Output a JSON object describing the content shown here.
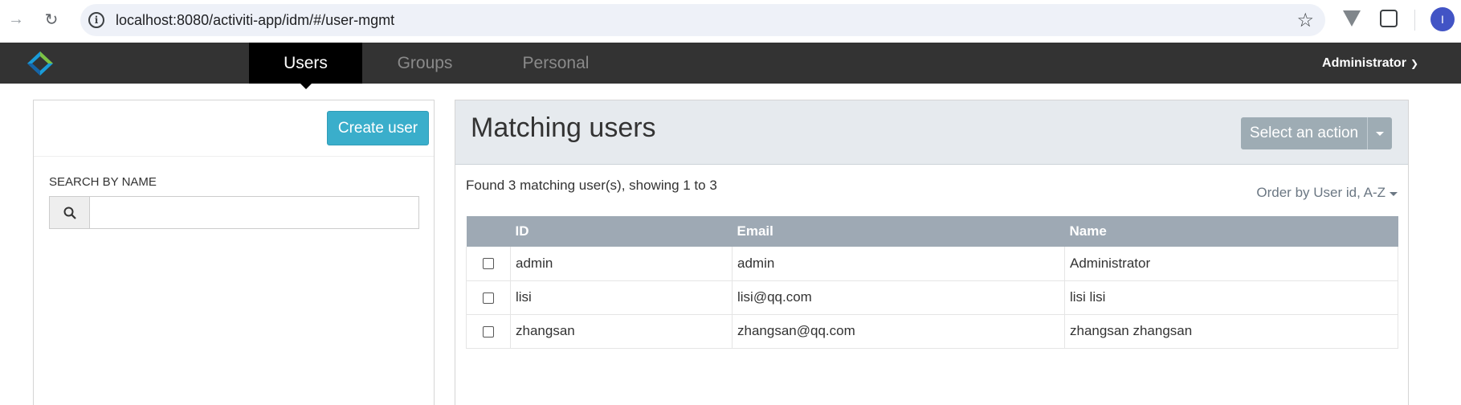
{
  "browser": {
    "url": "localhost:8080/activiti-app/idm/#/user-mgmt",
    "profile_initial": "I"
  },
  "nav": {
    "tabs": [
      {
        "label": "Users",
        "active": true
      },
      {
        "label": "Groups",
        "active": false
      },
      {
        "label": "Personal",
        "active": false
      }
    ],
    "user_menu": "Administrator"
  },
  "left": {
    "create_button": "Create user",
    "search_label": "SEARCH BY NAME",
    "search_value": ""
  },
  "right": {
    "title": "Matching users",
    "action_button": "Select an action",
    "found_text": "Found 3 matching user(s), showing 1 to 3",
    "order_text": "Order by User id, A-Z",
    "columns": [
      "ID",
      "Email",
      "Name"
    ],
    "rows": [
      {
        "id": "admin",
        "email": "admin",
        "name": "Administrator",
        "checked": false
      },
      {
        "id": "lisi",
        "email": "lisi@qq.com",
        "name": "lisi lisi",
        "checked": false
      },
      {
        "id": "zhangsan",
        "email": "zhangsan@qq.com",
        "name": "zhangsan zhangsan",
        "checked": false
      }
    ]
  },
  "colors": {
    "nav_bg": "#333333",
    "primary_button": "#3aaecb",
    "action_button": "#9eacb4",
    "table_header": "#9ea9b4",
    "panel_header": "#e6eaee"
  }
}
